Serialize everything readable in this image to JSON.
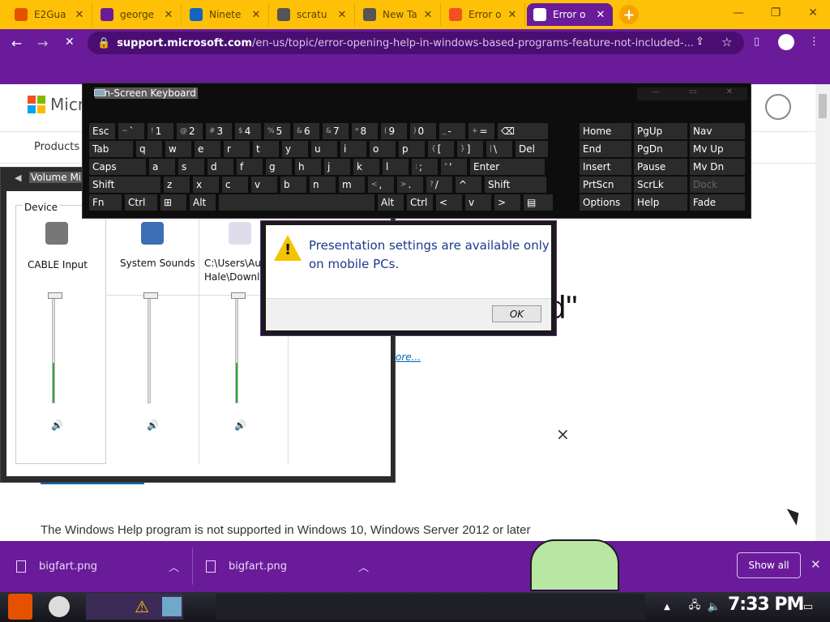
{
  "browser": {
    "tabs": [
      {
        "title": "E2Gua",
        "icon": "e2-icon",
        "color": "#e65100"
      },
      {
        "title": "george",
        "icon": "yahoo-icon",
        "color": "#6a1b9a"
      },
      {
        "title": "Ninete",
        "icon": "site-icon",
        "color": "#1565c0"
      },
      {
        "title": "scratu",
        "icon": "globe-icon",
        "color": "#555555"
      },
      {
        "title": "New Ta",
        "icon": "chrome-icon",
        "color": "#555555"
      },
      {
        "title": "Error o",
        "icon": "microsoft-icon",
        "color": "#f25022"
      },
      {
        "title": "Error o",
        "icon": "chrome-icon",
        "color": "#ffffff"
      }
    ],
    "url_domain": "support.microsoft.com",
    "url_path": "/en-us/topic/error-opening-help-in-windows-based-programs-feature-not-included-..."
  },
  "page": {
    "logo_text": "Micr",
    "nav_item": "Products",
    "heading_fragment": "d\"",
    "link_fragment": "ore...",
    "body_text": "The Windows Help program is not supported in Windows 10, Windows Server 2012 or later",
    "close_glyph": "×"
  },
  "osk": {
    "title": "On-Screen Keyboard",
    "rows": [
      [
        {
          "k": "Esc",
          "w": 34
        },
        {
          "k": "`",
          "s": "~",
          "w": 34
        },
        {
          "k": "1",
          "s": "!",
          "w": 34
        },
        {
          "k": "2",
          "s": "@",
          "w": 34
        },
        {
          "k": "3",
          "s": "#",
          "w": 34
        },
        {
          "k": "4",
          "s": "$",
          "w": 34
        },
        {
          "k": "5",
          "s": "%",
          "w": 34
        },
        {
          "k": "6",
          "s": "&",
          "w": 34
        },
        {
          "k": "7",
          "s": "&",
          "w": 34
        },
        {
          "k": "8",
          "s": "*",
          "w": 34
        },
        {
          "k": "9",
          "s": "(",
          "w": 34
        },
        {
          "k": "0",
          "s": ")",
          "w": 34
        },
        {
          "k": "-",
          "s": "_",
          "w": 34
        },
        {
          "k": "=",
          "s": "+",
          "w": 34
        },
        {
          "k": "⌫",
          "w": 64
        }
      ],
      [
        {
          "k": "Tab",
          "w": 56
        },
        {
          "k": "q",
          "w": 34
        },
        {
          "k": "w",
          "w": 34
        },
        {
          "k": "e",
          "w": 34
        },
        {
          "k": "r",
          "w": 34
        },
        {
          "k": "t",
          "w": 34
        },
        {
          "k": "y",
          "w": 34
        },
        {
          "k": "u",
          "w": 34
        },
        {
          "k": "i",
          "w": 34
        },
        {
          "k": "o",
          "w": 34
        },
        {
          "k": "p",
          "w": 34
        },
        {
          "k": "[",
          "s": "{",
          "w": 34
        },
        {
          "k": "]",
          "s": "}",
          "w": 34
        },
        {
          "k": "\\",
          "s": "|",
          "w": 34
        },
        {
          "k": "Del",
          "w": 42
        }
      ],
      [
        {
          "k": "Caps",
          "w": 72
        },
        {
          "k": "a",
          "w": 34
        },
        {
          "k": "s",
          "w": 34
        },
        {
          "k": "d",
          "w": 34
        },
        {
          "k": "f",
          "w": 34
        },
        {
          "k": "g",
          "w": 34
        },
        {
          "k": "h",
          "w": 34
        },
        {
          "k": "j",
          "w": 34
        },
        {
          "k": "k",
          "w": 34
        },
        {
          "k": "l",
          "w": 34
        },
        {
          "k": ";",
          "s": ":",
          "w": 34
        },
        {
          "k": "'",
          "s": "\"",
          "w": 34
        },
        {
          "k": "Enter",
          "w": 94
        }
      ],
      [
        {
          "k": "Shift",
          "w": 90
        },
        {
          "k": "z",
          "w": 34
        },
        {
          "k": "x",
          "w": 34
        },
        {
          "k": "c",
          "w": 34
        },
        {
          "k": "v",
          "w": 34
        },
        {
          "k": "b",
          "w": 34
        },
        {
          "k": "n",
          "w": 34
        },
        {
          "k": "m",
          "w": 34
        },
        {
          "k": ",",
          "s": "<",
          "w": 34
        },
        {
          "k": ".",
          "s": ">",
          "w": 34
        },
        {
          "k": "/",
          "s": "?",
          "w": 34
        },
        {
          "k": "^",
          "w": 34
        },
        {
          "k": "Shift",
          "w": 78
        }
      ],
      [
        {
          "k": "Fn",
          "w": 42
        },
        {
          "k": "Ctrl",
          "w": 42
        },
        {
          "k": "⊞",
          "w": 34
        },
        {
          "k": "Alt",
          "w": 34
        },
        {
          "k": "",
          "w": 194
        },
        {
          "k": "Alt",
          "w": 34
        },
        {
          "k": "Ctrl",
          "w": 34
        },
        {
          "k": "<",
          "w": 34
        },
        {
          "k": "v",
          "w": 34
        },
        {
          "k": ">",
          "w": 34
        },
        {
          "k": "▤",
          "w": 38
        }
      ]
    ],
    "side": [
      [
        "Home",
        "PgUp",
        "Nav"
      ],
      [
        "End",
        "PgDn",
        "Mv Up"
      ],
      [
        "Insert",
        "Pause",
        "Mv Dn"
      ],
      [
        "PrtScn",
        "ScrLk",
        "Dock"
      ],
      [
        "Options",
        "Help",
        "Fade"
      ]
    ]
  },
  "mixer": {
    "title": "Volume Mix",
    "device_label": "Device",
    "channels": [
      {
        "name": "CABLE Input",
        "level": 0.38,
        "icon": "speaker-icon"
      },
      {
        "name": "System Sounds",
        "level": 1.0,
        "icon": "speaker-icon"
      },
      {
        "name": "C:\\Users\\Au",
        "name2": "Hale\\Downlo",
        "level": 0.38,
        "icon": "speaker-icon"
      }
    ]
  },
  "dialog": {
    "line1": "Presentation settings are available only",
    "line2": "on mobile PCs.",
    "ok": "OK"
  },
  "downloads": {
    "items": [
      "bigfart.png",
      "bigfart.png"
    ],
    "show_all": "Show all"
  },
  "taskbar": {
    "clock": "7:33 PM"
  }
}
